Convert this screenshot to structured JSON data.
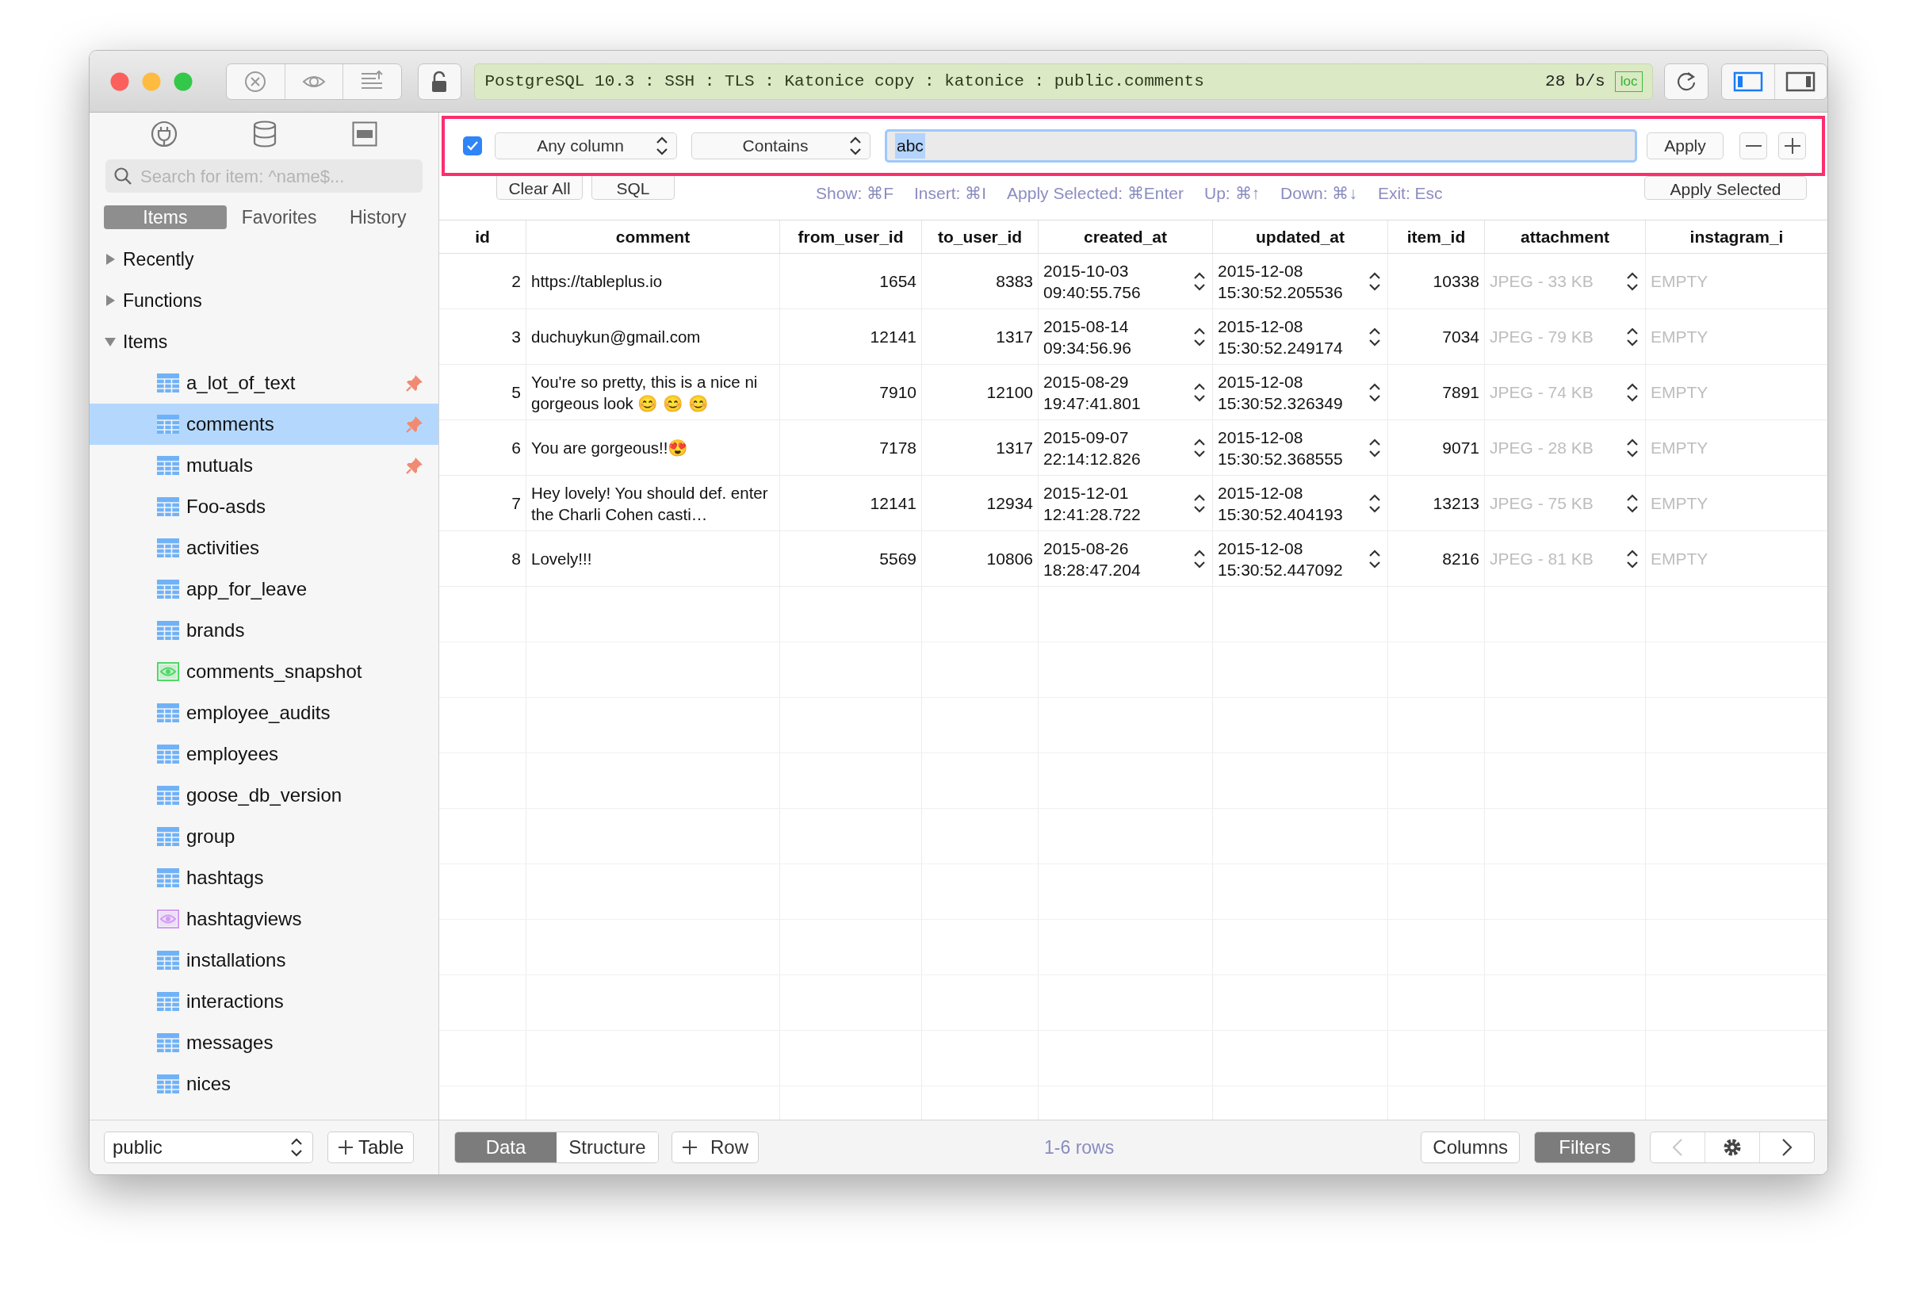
{
  "toolbar": {
    "connection": "PostgreSQL 10.3 : SSH : TLS : Katonice copy : katonice : public.comments",
    "speed": "28 b/s",
    "badge": "loc",
    "panels": [
      {
        "kind": "left",
        "on": true
      },
      {
        "kind": "right",
        "on": false
      }
    ]
  },
  "sidebar": {
    "tabs": [
      {
        "label": "Items",
        "selected": true
      },
      {
        "label": "Favorites",
        "selected": false
      },
      {
        "label": "History",
        "selected": false
      }
    ],
    "search": {
      "placeholder": "Search for item: ^name$..."
    },
    "tree": [
      {
        "label": "Recently",
        "expanded": false
      },
      {
        "label": "Functions",
        "expanded": false
      },
      {
        "label": "Items",
        "expanded": true,
        "children": [
          {
            "label": "a_lot_of_text",
            "kind": "table",
            "pinned": true,
            "selected": false
          },
          {
            "label": "comments",
            "kind": "table",
            "pinned": true,
            "selected": true
          },
          {
            "label": "mutuals",
            "kind": "table",
            "pinned": true,
            "selected": false
          },
          {
            "label": "Foo-asds",
            "kind": "table",
            "pinned": false,
            "selected": false
          },
          {
            "label": "activities",
            "kind": "table",
            "pinned": false,
            "selected": false
          },
          {
            "label": "app_for_leave",
            "kind": "table",
            "pinned": false,
            "selected": false
          },
          {
            "label": "brands",
            "kind": "table",
            "pinned": false,
            "selected": false
          },
          {
            "label": "comments_snapshot",
            "kind": "view",
            "color": "#4cd964",
            "pinned": false,
            "selected": false
          },
          {
            "label": "employee_audits",
            "kind": "table",
            "pinned": false,
            "selected": false
          },
          {
            "label": "employees",
            "kind": "table",
            "pinned": false,
            "selected": false
          },
          {
            "label": "goose_db_version",
            "kind": "table",
            "pinned": false,
            "selected": false
          },
          {
            "label": "group",
            "kind": "table",
            "pinned": false,
            "selected": false
          },
          {
            "label": "hashtags",
            "kind": "table",
            "pinned": false,
            "selected": false
          },
          {
            "label": "hashtagviews",
            "kind": "view",
            "color": "#d29cf5",
            "pinned": false,
            "selected": false
          },
          {
            "label": "installations",
            "kind": "table",
            "pinned": false,
            "selected": false
          },
          {
            "label": "interactions",
            "kind": "table",
            "pinned": false,
            "selected": false
          },
          {
            "label": "messages",
            "kind": "table",
            "pinned": false,
            "selected": false
          },
          {
            "label": "nices",
            "kind": "table",
            "pinned": false,
            "selected": false
          }
        ]
      }
    ],
    "schema": "public",
    "add_button": "Table"
  },
  "filter": {
    "enabled": true,
    "column": "Any column",
    "operator": "Contains",
    "value": "abc",
    "apply": "Apply",
    "actions": [
      "Clear All",
      "SQL"
    ],
    "hints": [
      "Show: ⌘F",
      "Insert: ⌘I",
      "Apply Selected: ⌘Enter",
      "Up: ⌘↑",
      "Down: ⌘↓",
      "Exit: Esc"
    ],
    "apply_selected": "Apply Selected"
  },
  "table": {
    "columns": [
      {
        "label": "id",
        "kind": "number"
      },
      {
        "label": "comment",
        "kind": "text"
      },
      {
        "label": "from_user_id",
        "kind": "number"
      },
      {
        "label": "to_user_id",
        "kind": "number"
      },
      {
        "label": "created_at",
        "kind": "timestamp"
      },
      {
        "label": "updated_at",
        "kind": "timestamp"
      },
      {
        "label": "item_id",
        "kind": "number"
      },
      {
        "label": "attachment",
        "kind": "binary"
      },
      {
        "label": "instagram_i",
        "kind": "empty"
      }
    ],
    "rows": [
      [
        "2",
        "https://tableplus.io",
        "1654",
        "8383",
        "2015-10-03 09:40:55.756",
        "2015-12-08 15:30:52.205536",
        "10338",
        "JPEG - 33 KB",
        "EMPTY"
      ],
      [
        "3",
        "duchuykun@gmail.com",
        "12141",
        "1317",
        "2015-08-14 09:34:56.96",
        "2015-12-08 15:30:52.249174",
        "7034",
        "JPEG - 79 KB",
        "EMPTY"
      ],
      [
        "5",
        "You're so pretty, this is a nice ni gorgeous look 😊 😊 😊",
        "7910",
        "12100",
        "2015-08-29 19:47:41.801",
        "2015-12-08 15:30:52.326349",
        "7891",
        "JPEG - 74 KB",
        "EMPTY"
      ],
      [
        "6",
        "You are gorgeous!!😍",
        "7178",
        "1317",
        "2015-09-07 22:14:12.826",
        "2015-12-08 15:30:52.368555",
        "9071",
        "JPEG - 28 KB",
        "EMPTY"
      ],
      [
        "7",
        "Hey lovely! You should def. enter the Charli Cohen casti…",
        "12141",
        "12934",
        "2015-12-01 12:41:28.722",
        "2015-12-08 15:30:52.404193",
        "13213",
        "JPEG - 75 KB",
        "EMPTY"
      ],
      [
        "8",
        "Lovely!!!",
        "5569",
        "10806",
        "2015-08-26 18:28:47.204",
        "2015-12-08 15:30:52.447092",
        "8216",
        "JPEG - 81 KB",
        "EMPTY"
      ]
    ]
  },
  "bottom": {
    "views": [
      {
        "label": "Data",
        "selected": true
      },
      {
        "label": "Structure",
        "selected": false
      }
    ],
    "add_row": "Row",
    "count": "1-6 rows",
    "columns_button": "Columns",
    "filters": {
      "label": "Filters",
      "selected": true
    }
  }
}
